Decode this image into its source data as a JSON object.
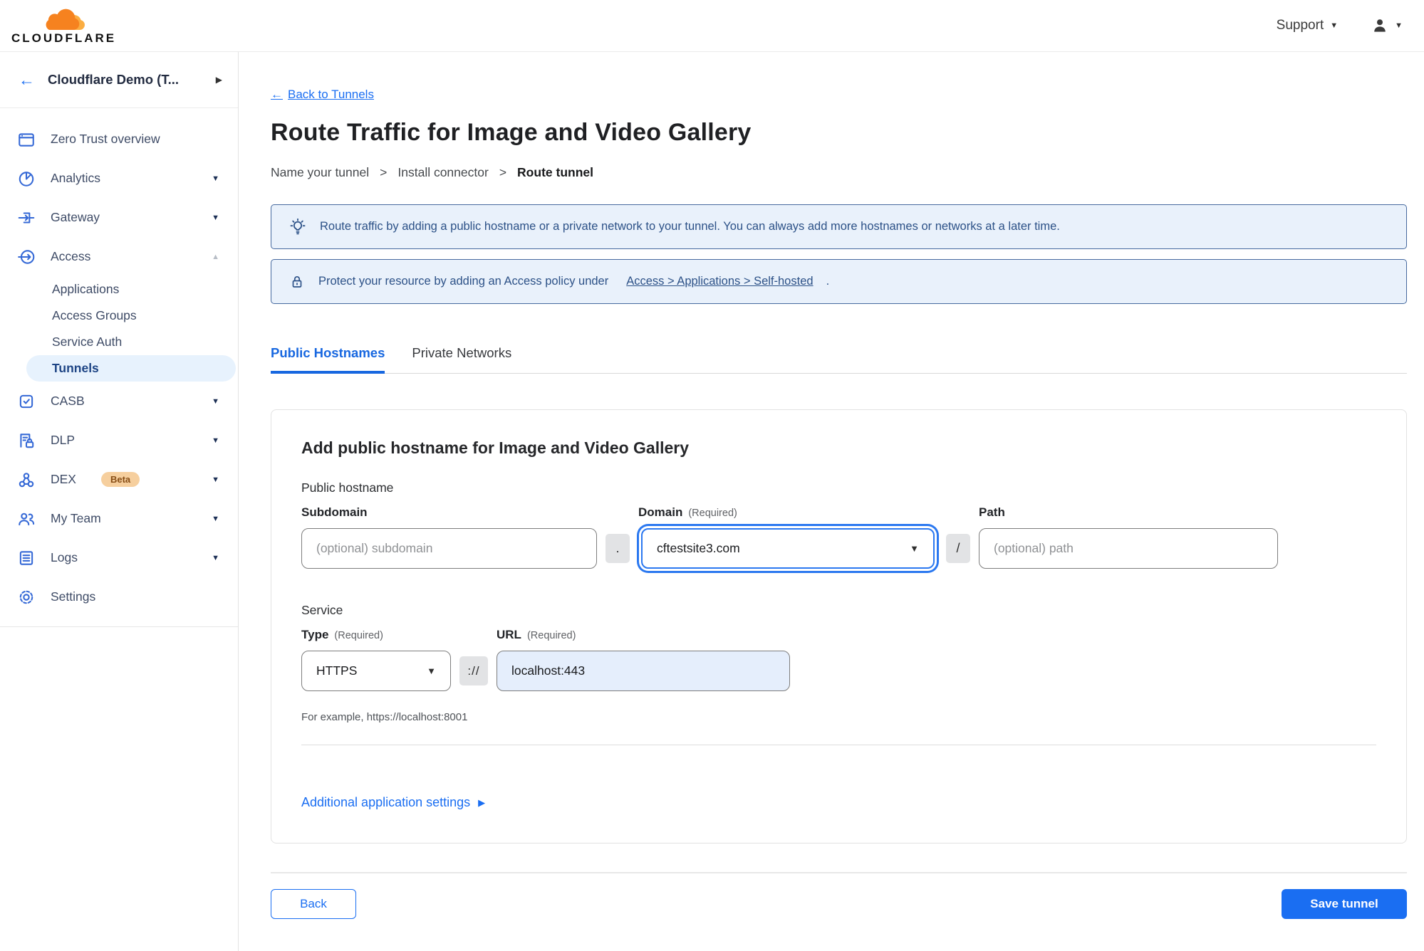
{
  "topbar": {
    "brand": "CLOUDFLARE",
    "support": "Support"
  },
  "sidebar": {
    "account": "Cloudflare Demo (T...",
    "items": [
      {
        "label": "Zero Trust overview"
      },
      {
        "label": "Analytics"
      },
      {
        "label": "Gateway"
      },
      {
        "label": "Access"
      },
      {
        "label": "CASB"
      },
      {
        "label": "DLP"
      },
      {
        "label": "DEX",
        "badge": "Beta"
      },
      {
        "label": "My Team"
      },
      {
        "label": "Logs"
      },
      {
        "label": "Settings"
      }
    ],
    "access_sub": [
      {
        "label": "Applications"
      },
      {
        "label": "Access Groups"
      },
      {
        "label": "Service Auth"
      },
      {
        "label": "Tunnels",
        "selected": true
      }
    ]
  },
  "header": {
    "back": "Back to Tunnels",
    "title": "Route Traffic for Image and Video Gallery",
    "sep": ">",
    "steps": [
      {
        "label": "Name your tunnel"
      },
      {
        "label": "Install connector"
      },
      {
        "label": "Route tunnel",
        "current": true
      }
    ]
  },
  "banners": {
    "tip": "Route traffic by adding a public hostname or a private network to your tunnel. You can always add more hostnames or networks at a later time.",
    "protect_prefix": "Protect your resource by adding an Access policy under",
    "protect_link": "Access > Applications > Self-hosted",
    "protect_suffix": "."
  },
  "tabs": {
    "public": "Public Hostnames",
    "private": "Private Networks"
  },
  "form": {
    "heading": "Add public hostname for Image and Video Gallery",
    "group_label": "Public hostname",
    "subdomain": {
      "label": "Subdomain",
      "placeholder": "(optional) subdomain"
    },
    "domain": {
      "label": "Domain",
      "note": "(Required)",
      "value": "cftestsite3.com"
    },
    "path": {
      "label": "Path",
      "placeholder": "(optional) path"
    },
    "sep_dot": ".",
    "sep_slash": "/",
    "sep_scheme": "://",
    "service_label": "Service",
    "type": {
      "label": "Type",
      "note": "(Required)",
      "value": "HTTPS"
    },
    "url": {
      "label": "URL",
      "note": "(Required)",
      "value": "localhost:443"
    },
    "hint": "For example, https://localhost:8001",
    "additional": "Additional application settings"
  },
  "footer": {
    "back": "Back",
    "save": "Save tunnel"
  },
  "colors": {
    "accent": "#1a6ef2",
    "tab_active": "#1767e0",
    "banner_bg": "#e9f1fb",
    "banner_border": "#46699f",
    "banner_text": "#2c5187",
    "selected_nav_bg": "#e7f2fd",
    "beta_badge_bg": "#f6cf9e",
    "beta_badge_text": "#874d15",
    "logo_orange": "#f6821f",
    "logo_orange_light": "#fbad41",
    "url_input_bg": "#e5eefc"
  }
}
